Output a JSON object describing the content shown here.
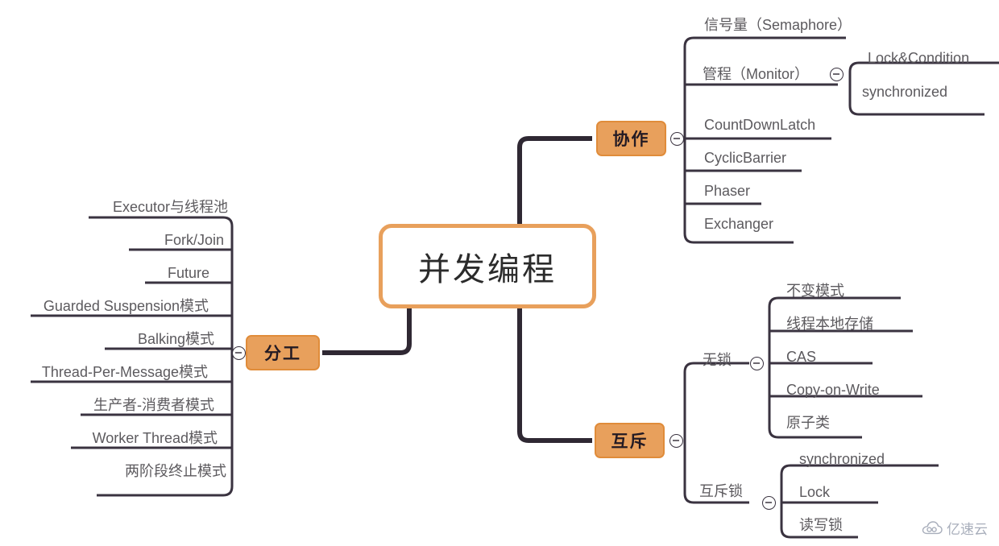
{
  "root": {
    "label": "并发编程"
  },
  "branches": [
    {
      "id": "division",
      "label": "分工",
      "side": "left",
      "collapse_icon": "minus-circle-icon",
      "items": [
        {
          "label": "Executor与线程池"
        },
        {
          "label": "Fork/Join"
        },
        {
          "label": "Future"
        },
        {
          "label": "Guarded Suspension模式"
        },
        {
          "label": "Balking模式"
        },
        {
          "label": "Thread-Per-Message模式"
        },
        {
          "label": "生产者-消费者模式"
        },
        {
          "label": "Worker Thread模式"
        },
        {
          "label": "两阶段终止模式"
        }
      ]
    },
    {
      "id": "cooperation",
      "label": "协作",
      "side": "right",
      "collapse_icon": "minus-circle-icon",
      "items": [
        {
          "label": "信号量（Semaphore）"
        },
        {
          "label": "管程（Monitor）",
          "collapse_icon": "minus-circle-icon",
          "children": [
            {
              "label": "Lock&Condition"
            },
            {
              "label": "synchronized"
            }
          ]
        },
        {
          "label": "CountDownLatch"
        },
        {
          "label": "CyclicBarrier"
        },
        {
          "label": "Phaser"
        },
        {
          "label": "Exchanger"
        }
      ]
    },
    {
      "id": "mutex",
      "label": "互斥",
      "side": "right",
      "collapse_icon": "minus-circle-icon",
      "items": [
        {
          "label": "无锁",
          "collapse_icon": "minus-circle-icon",
          "children": [
            {
              "label": "不变模式"
            },
            {
              "label": "线程本地存储"
            },
            {
              "label": "CAS"
            },
            {
              "label": "Copy-on-Write"
            },
            {
              "label": "原子类"
            }
          ]
        },
        {
          "label": "互斥锁",
          "collapse_icon": "minus-circle-icon",
          "children": [
            {
              "label": "synchronized"
            },
            {
              "label": "Lock"
            },
            {
              "label": "读写锁"
            }
          ]
        }
      ]
    }
  ],
  "watermark": {
    "text": "亿速云",
    "icon": "cloud-icon"
  },
  "colors": {
    "node_fill": "#e8a05c",
    "node_stroke": "#e08c3a",
    "wire": "#3a3340",
    "text": "#5c5a5e"
  }
}
